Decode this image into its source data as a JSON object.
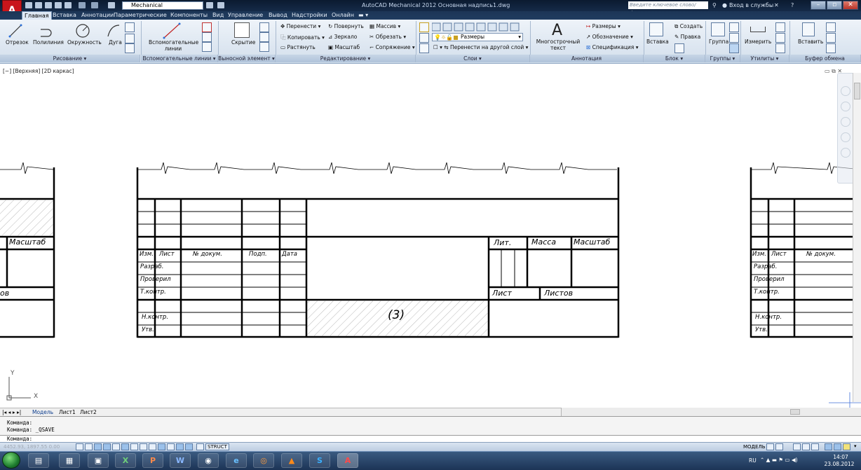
{
  "titlebar": {
    "workspace": "Mechanical",
    "app_title": "AutoCAD Mechanical 2012   Основная надпись1.dwg",
    "search_placeholder": "Введите ключевое слово/фразу",
    "signin": "Вход в службы",
    "logo_letter": "A",
    "logo_sub": "M"
  },
  "tabs": [
    "Главная",
    "Вставка",
    "Аннотации",
    "Параметрические",
    "Компоненты",
    "Вид",
    "Управление",
    "Вывод",
    "Надстройки",
    "Онлайн"
  ],
  "ribbon": {
    "draw": {
      "items": [
        "Отрезок",
        "Полилиния",
        "Окружность",
        "Дуга"
      ],
      "title": "Рисование ▾"
    },
    "aux": {
      "item": "Вспомогательные линии",
      "title": "Вспомогательные линии ▾"
    },
    "callout": {
      "item": "Скрытие",
      "title": "Выносной элемент ▾"
    },
    "modify": {
      "items": [
        "Перенести ▾",
        "Повернуть",
        "Массив ▾",
        "Копировать ▾",
        "Зеркало",
        "Обрезать ▾",
        "Растянуть",
        "Масштаб",
        "Сопряжение ▾"
      ],
      "title": "Редактирование ▾"
    },
    "layers": {
      "current": "Размеры",
      "move": "Перенести на другой слой ▾",
      "title": "Слои ▾"
    },
    "annotation": {
      "text": "Многострочный текст",
      "items": [
        "Размеры ▾",
        "Обозначение ▾",
        "Спецификация ▾"
      ],
      "title": "Аннотация"
    },
    "block": {
      "insert": "Вставка",
      "create": "Создать",
      "edit": "Правка",
      "title": "Блок ▾"
    },
    "groups": {
      "item": "Группа",
      "title": "Группы ▾"
    },
    "utils": {
      "item": "Измерить",
      "title": "Утилиты ▾"
    },
    "clipboard": {
      "item": "Вставить",
      "title": "Буфер обмена"
    }
  },
  "viewport_label": "[−] [Верхняя] [2D каркас]",
  "titleblock": {
    "headers": [
      "Изм.",
      "Лист",
      "№ докум.",
      "Подп.",
      "Дата"
    ],
    "rows": [
      "Разраб.",
      "Проверил",
      "Т.контр.",
      "Н.контр.",
      "Утв."
    ],
    "lit": "Лит.",
    "mass": "Масса",
    "scale": "Масштаб",
    "sheet": "Лист",
    "sheets": "Листов",
    "field3": "(3)"
  },
  "left_partial": {
    "scale": "Масштаб",
    "sheets": "ов"
  },
  "right_partial": {
    "headers": [
      "Изм.",
      "Лист",
      "№ докум."
    ],
    "rows": [
      "Разраб.",
      "Проверил",
      "Т.контр.",
      "Н.контр.",
      "Утв."
    ]
  },
  "layout_tabs": [
    "Модель",
    "Лист1",
    "Лист2"
  ],
  "command": {
    "lines": [
      "Команда:",
      "Команда: _QSAVE"
    ],
    "prompt": "Команда:"
  },
  "status": {
    "coords": "4452.93, 1897.55 0.00",
    "struct": "STRUCT",
    "model": "МОДЕЛЬ"
  },
  "taskbar": {
    "lang": "RU",
    "time": "14:07",
    "date": "23.08.2012"
  },
  "axis": {
    "x": "X",
    "y": "Y"
  }
}
